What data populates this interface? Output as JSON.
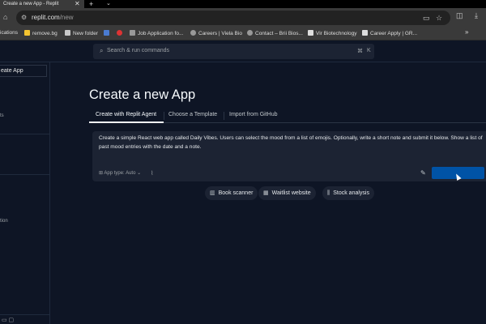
{
  "browser": {
    "tab_title": "Create a new App - Replit",
    "tab_close": "✕",
    "new_tab": "+",
    "tab_menu": "⌄",
    "url_host": "replit.com",
    "url_path": "/new",
    "bookmarks": [
      {
        "label": "ications",
        "icon": "apps-icon",
        "color": ""
      },
      {
        "label": "remove.bg",
        "icon": "removebg-icon",
        "color": "#f4c430"
      },
      {
        "label": "New folder",
        "icon": "folder-icon",
        "color": "#c8c8c8"
      },
      {
        "label": "",
        "icon": "bookmark-icon",
        "color": "#4a7bd0"
      },
      {
        "label": "",
        "icon": "bookmark-red-icon",
        "color": "#d33"
      },
      {
        "label": "Job Application fo...",
        "icon": "document-icon",
        "color": "#999"
      },
      {
        "label": "Careers | Viela Bio",
        "icon": "gear-icon",
        "color": "#999"
      },
      {
        "label": "Contact – Brii Bios...",
        "icon": "gear-icon",
        "color": "#999"
      },
      {
        "label": "Vir Biotechnology",
        "icon": "vir-icon",
        "color": "#ddd"
      },
      {
        "label": "Career Apply | GR...",
        "icon": "g-icon",
        "color": "#ddd"
      }
    ],
    "bookmarks_more": "»"
  },
  "app": {
    "search_placeholder": "Search & run commands",
    "search_kbd_1": "⌘",
    "search_kbd_2": "K",
    "sidebar": {
      "create_app_label": "eate App",
      "frag_1": "ts",
      "frag_2": "tion"
    },
    "page_title": "Create a new App",
    "tabs": [
      {
        "label": "Create with Replit Agent",
        "active": true
      },
      {
        "label": "Choose a Template",
        "active": false
      },
      {
        "label": "Import from GitHub",
        "active": false
      }
    ],
    "prompt_text": "Create a simple React web app called Daily Vibes. Users can select the mood from a list of emojis. Optionally, write a short note and submit it below. Show a list of past mood entries with the date and a note.",
    "app_type_label": "App type:",
    "app_type_value": "Auto",
    "submit_label": "",
    "suggestions": [
      {
        "label": "Book scanner",
        "icon": "book-icon"
      },
      {
        "label": "Waitlist website",
        "icon": "calendar-icon"
      },
      {
        "label": "Stock analysis",
        "icon": "chart-icon"
      }
    ]
  }
}
